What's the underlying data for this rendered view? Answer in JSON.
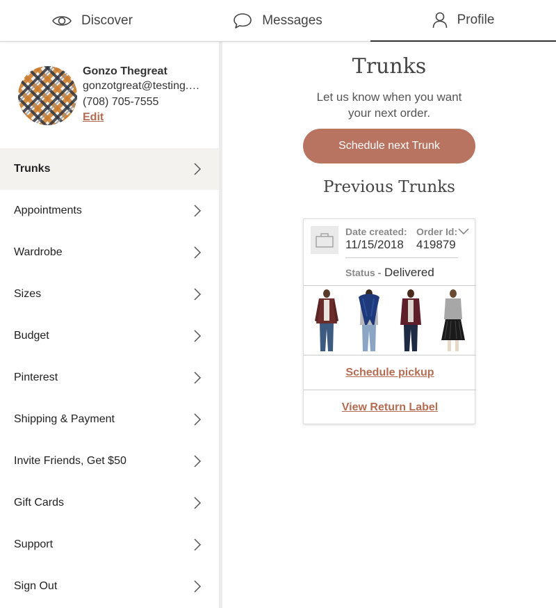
{
  "nav": {
    "tabs": [
      {
        "label": "Discover",
        "icon": "eye-icon"
      },
      {
        "label": "Messages",
        "icon": "chat-bubble-icon"
      },
      {
        "label": "Profile",
        "icon": "person-icon",
        "active": true
      }
    ]
  },
  "profile": {
    "name": "Gonzo Thegreat",
    "email": "gonzotgreat@testing.com",
    "phone": "(708) 705-7555",
    "edit_label": "Edit"
  },
  "menu": {
    "items": [
      {
        "label": "Trunks",
        "active": true
      },
      {
        "label": "Appointments"
      },
      {
        "label": "Wardrobe"
      },
      {
        "label": "Sizes"
      },
      {
        "label": "Budget"
      },
      {
        "label": "Pinterest"
      },
      {
        "label": "Shipping & Payment"
      },
      {
        "label": "Invite Friends, Get $50"
      },
      {
        "label": "Gift Cards"
      },
      {
        "label": "Support"
      },
      {
        "label": "Sign Out"
      }
    ]
  },
  "main": {
    "title": "Trunks",
    "subtitle": "Let us know when you want your next order.",
    "schedule_button": "Schedule next Trunk",
    "previous_title": "Previous Trunks"
  },
  "trunk": {
    "date_label": "Date created:",
    "date_value": "11/15/2018",
    "order_label": "Order Id:",
    "order_value": "419879",
    "status_label": "Status -",
    "status_value": "Delivered",
    "schedule_pickup": "Schedule pickup",
    "return_label": "View Return Label"
  },
  "colors": {
    "accent": "#b87460",
    "link": "#b46c52",
    "active_menu_bg": "#f3f2ef"
  }
}
